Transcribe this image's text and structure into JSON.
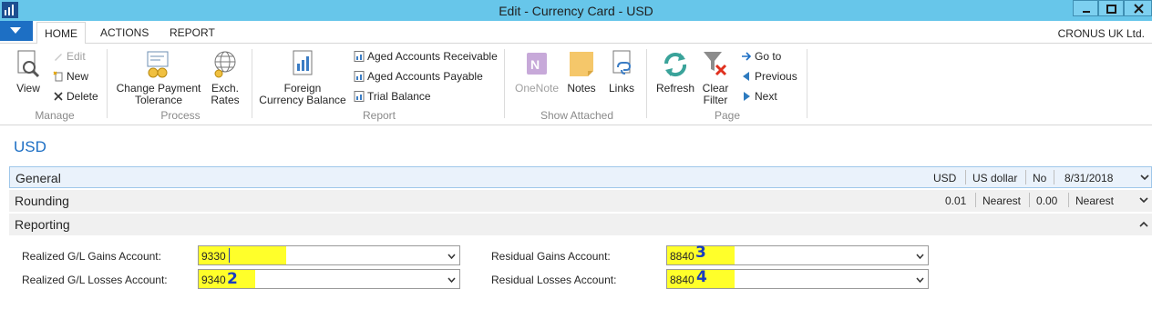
{
  "window": {
    "title": "Edit - Currency Card - USD",
    "company": "CRONUS UK Ltd."
  },
  "tabs": [
    {
      "label": "HOME"
    },
    {
      "label": "ACTIONS"
    },
    {
      "label": "REPORT"
    }
  ],
  "ribbon": {
    "manage": {
      "group_label": "Manage",
      "view": "View",
      "edit": "Edit",
      "new": "New",
      "delete": "Delete"
    },
    "process": {
      "group_label": "Process",
      "change_payment_line1": "Change Payment",
      "change_payment_line2": "Tolerance",
      "exch_line1": "Exch.",
      "exch_line2": "Rates"
    },
    "report": {
      "group_label": "Report",
      "foreign_line1": "Foreign",
      "foreign_line2": "Currency Balance",
      "aged_receivable": "Aged Accounts Receivable",
      "aged_payable": "Aged Accounts Payable",
      "trial_balance": "Trial Balance"
    },
    "show_attached": {
      "group_label": "Show Attached",
      "onenote": "OneNote",
      "notes": "Notes",
      "links": "Links"
    },
    "page": {
      "group_label": "Page",
      "refresh": "Refresh",
      "clear_line1": "Clear",
      "clear_line2": "Filter",
      "goto": "Go to",
      "previous": "Previous",
      "next": "Next"
    }
  },
  "page_title": "USD",
  "fasttabs": {
    "general": {
      "title": "General",
      "summary": [
        "USD",
        "US dollar",
        "No",
        "8/31/2018"
      ]
    },
    "rounding": {
      "title": "Rounding",
      "summary": [
        "0.01",
        "Nearest",
        "0.00",
        "Nearest"
      ]
    },
    "reporting": {
      "title": "Reporting"
    }
  },
  "fields": {
    "realized_gains": {
      "label": "Realized G/L Gains Account:",
      "value": "9330"
    },
    "realized_losses": {
      "label": "Realized G/L Losses Account:",
      "value": "9340"
    },
    "residual_gains": {
      "label": "Residual Gains Account:",
      "value": "8840"
    },
    "residual_losses": {
      "label": "Residual Losses Account:",
      "value": "8840"
    }
  },
  "annotations": {
    "realized_losses": "2",
    "residual_gains": "3",
    "residual_losses": "4"
  },
  "colors": {
    "titlebar": "#67c6ea",
    "accent": "#1d6fc4",
    "highlight": "#ffff2a",
    "handwriting": "#1a3dbf"
  }
}
